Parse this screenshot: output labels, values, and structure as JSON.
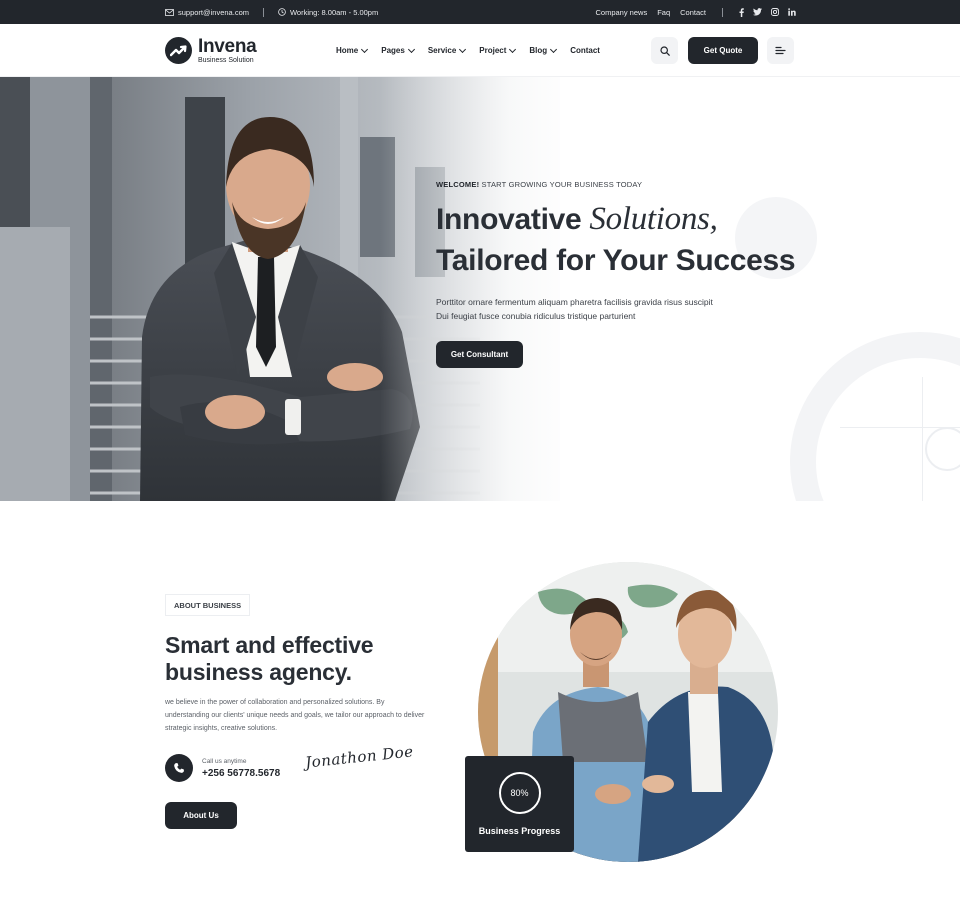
{
  "topbar": {
    "email": "support@invena.com",
    "hours": "Working: 8.00am - 5.00pm",
    "links": [
      "Company news",
      "Faq",
      "Contact"
    ],
    "social": [
      "facebook-icon",
      "twitter-icon",
      "instagram-icon",
      "linkedin-icon"
    ]
  },
  "header": {
    "logo_name": "Invena",
    "logo_tagline": "Business Solution",
    "nav": [
      {
        "label": "Home",
        "dropdown": true
      },
      {
        "label": "Pages",
        "dropdown": true
      },
      {
        "label": "Service",
        "dropdown": true
      },
      {
        "label": "Project",
        "dropdown": true
      },
      {
        "label": "Blog",
        "dropdown": true
      },
      {
        "label": "Contact",
        "dropdown": false
      }
    ],
    "quote_button": "Get Quote"
  },
  "hero": {
    "eyebrow_bold": "WELCOME!",
    "eyebrow_rest": " START GROWING YOUR BUSINESS TODAY",
    "title_part1": "Innovative ",
    "title_italic": "Solutions,",
    "title_line2": "Tailored for Your Success",
    "description_line1": "Porttitor ornare fermentum aliquam pharetra facilisis gravida risus suscipit",
    "description_line2": "Dui feugiat fusce conubia ridiculus tristique parturient",
    "cta": "Get Consultant"
  },
  "about": {
    "badge": "ABOUT BUSINESS",
    "title_line1": "Smart and effective",
    "title_line2": "business agency.",
    "text": "we believe in the power of collaboration and personalized solutions. By understanding our clients' unique needs and goals, we tailor our approach to deliver strategic insights, creative solutions.",
    "call_label": "Call us anytime",
    "call_number": "+256 56778.5678",
    "signature": "Jonathon Doe",
    "button": "About Us",
    "progress_value": "80%",
    "progress_label": "Business Progress"
  },
  "colors": {
    "dark": "#22262c",
    "light_bg": "#f2f3f5"
  }
}
